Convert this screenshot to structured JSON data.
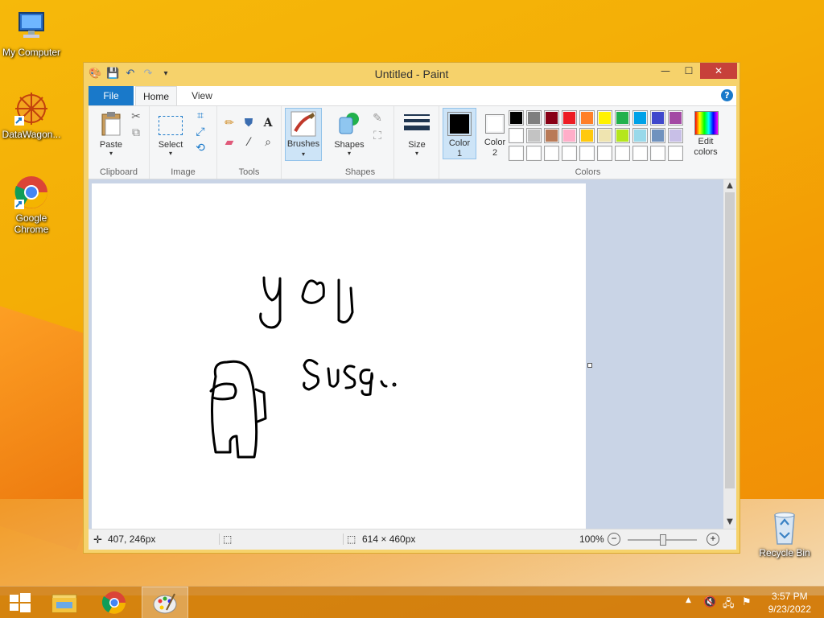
{
  "desktop": {
    "icons": [
      {
        "label": "My Computer"
      },
      {
        "label": "DataWagon..."
      },
      {
        "label": "Google Chrome"
      },
      {
        "label": "Recycle Bin"
      }
    ]
  },
  "window": {
    "title": "Untitled - Paint",
    "controls": {
      "minimize": "—",
      "maximize": "☐",
      "close": "✕"
    },
    "tabs": [
      {
        "label": "File"
      },
      {
        "label": "Home"
      },
      {
        "label": "View"
      }
    ],
    "help": "?"
  },
  "ribbon": {
    "groups": {
      "clipboard": "Clipboard",
      "image": "Image",
      "tools": "Tools",
      "shapes": "Shapes",
      "colors": "Colors"
    },
    "paste": "Paste",
    "select": "Select",
    "brushes": "Brushes",
    "shapes_btn": "Shapes",
    "size": "Size",
    "color1": "Color",
    "color1_num": "1",
    "color2": "Color",
    "color2_num": "2",
    "edit_colors_line1": "Edit",
    "edit_colors_line2": "colors"
  },
  "palette": {
    "row1": [
      "#000000",
      "#7f7f7f",
      "#880015",
      "#ed1c24",
      "#ff7f27",
      "#fff200",
      "#22b14c",
      "#00a2e8",
      "#3f48cc",
      "#a349a4"
    ],
    "row2": [
      "#ffffff",
      "#c3c3c3",
      "#b97a57",
      "#ffaec9",
      "#ffc90e",
      "#efe4b0",
      "#b5e61d",
      "#99d9ea",
      "#7092be",
      "#c8bfe7"
    ],
    "row3": [
      "#ffffff",
      "#ffffff",
      "#ffffff",
      "#ffffff",
      "#ffffff",
      "#ffffff",
      "#ffffff",
      "#ffffff",
      "#ffffff",
      "#ffffff"
    ],
    "color1": "#000000",
    "color2": "#ffffff"
  },
  "status": {
    "cursor_pos": "407, 246px",
    "image_size": "614 × 460px",
    "zoom": "100%"
  },
  "taskbar": {
    "time": "3:57 PM",
    "date": "9/23/2022"
  },
  "colors": {
    "accent": "#1979ca",
    "close": "#c7403a",
    "window_frame": "#f6d26b"
  }
}
